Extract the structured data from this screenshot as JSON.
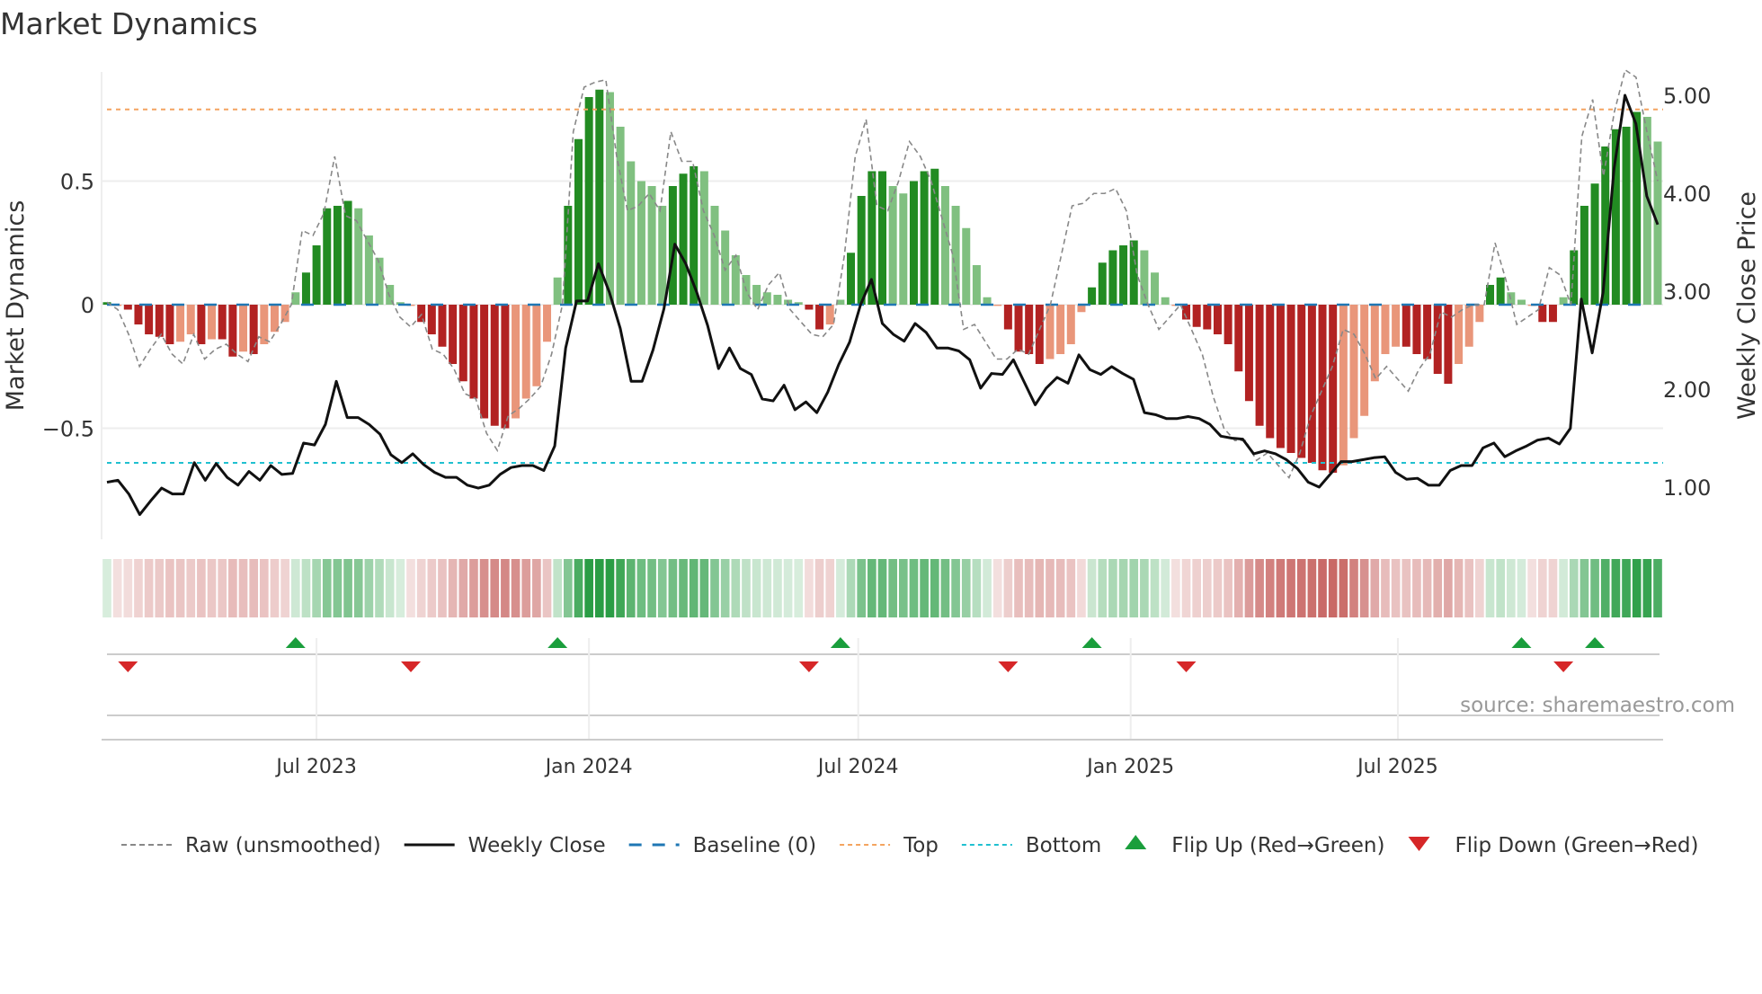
{
  "title": "Market Dynamics",
  "source": "source: sharemaestro.com",
  "colors": {
    "green_dark": "#228b22",
    "green_light": "#80c080",
    "red_dark": "#b22222",
    "red_light": "#e9967a",
    "raw": "#888888",
    "close": "#111111",
    "baseline": "#1f77b4",
    "top": "#f4a460",
    "bottom": "#20c0d0",
    "flip_up": "#1a9e3c",
    "flip_down": "#d62728"
  },
  "chart_data": {
    "type": "bar",
    "title": "Market Dynamics",
    "ylabel": "Market Dynamics",
    "y2label": "Weekly Close Price",
    "ylim": [
      -0.95,
      0.95
    ],
    "y2lim": [
      0.5,
      5.25
    ],
    "yticks": [
      {
        "v": 0.5,
        "label": "0.5"
      },
      {
        "v": 0,
        "label": "0"
      },
      {
        "v": -0.5,
        "label": "−0.5"
      }
    ],
    "y2ticks": [
      {
        "v": 5,
        "label": "5.00"
      },
      {
        "v": 4,
        "label": "4.00"
      },
      {
        "v": 3,
        "label": "3.00"
      },
      {
        "v": 2,
        "label": "2.00"
      },
      {
        "v": 1,
        "label": "1.00"
      }
    ],
    "xticks": [
      {
        "week": 20.0,
        "label": "Jul 2023"
      },
      {
        "week": 46.0,
        "label": "Jan 2024"
      },
      {
        "week": 71.7,
        "label": "Jul 2024"
      },
      {
        "week": 97.7,
        "label": "Jan 2025"
      },
      {
        "week": 123.2,
        "label": "Jul 2025"
      }
    ],
    "top_level": 0.79,
    "bottom_level": -0.64,
    "baseline": 0,
    "bars": [
      0.01,
      -0.005,
      -0.02,
      -0.08,
      -0.12,
      -0.13,
      -0.16,
      -0.15,
      -0.12,
      -0.16,
      -0.14,
      -0.14,
      -0.21,
      -0.19,
      -0.2,
      -0.16,
      -0.11,
      -0.07,
      0.05,
      0.13,
      0.24,
      0.39,
      0.4,
      0.42,
      0.39,
      0.28,
      0.19,
      0.08,
      0.01,
      -0.005,
      -0.07,
      -0.12,
      -0.17,
      -0.24,
      -0.31,
      -0.38,
      -0.46,
      -0.49,
      -0.5,
      -0.46,
      -0.38,
      -0.33,
      -0.15,
      0.11,
      0.4,
      0.67,
      0.84,
      0.87,
      0.86,
      0.72,
      0.58,
      0.5,
      0.48,
      0.4,
      0.48,
      0.53,
      0.56,
      0.54,
      0.4,
      0.3,
      0.2,
      0.12,
      0.08,
      0.05,
      0.04,
      0.02,
      0.01,
      -0.02,
      -0.1,
      -0.08,
      0.02,
      0.21,
      0.44,
      0.54,
      0.54,
      0.48,
      0.45,
      0.5,
      0.54,
      0.55,
      0.48,
      0.4,
      0.31,
      0.16,
      0.03,
      -0.005,
      -0.1,
      -0.19,
      -0.2,
      -0.24,
      -0.22,
      -0.2,
      -0.16,
      -0.03,
      0.07,
      0.17,
      0.22,
      0.24,
      0.26,
      0.22,
      0.13,
      0.03,
      -0.005,
      -0.06,
      -0.09,
      -0.1,
      -0.12,
      -0.16,
      -0.27,
      -0.39,
      -0.49,
      -0.54,
      -0.58,
      -0.6,
      -0.62,
      -0.64,
      -0.67,
      -0.68,
      -0.65,
      -0.54,
      -0.45,
      -0.31,
      -0.2,
      -0.17,
      -0.17,
      -0.2,
      -0.22,
      -0.28,
      -0.32,
      -0.24,
      -0.17,
      -0.07,
      0.08,
      0.11,
      0.05,
      0.02,
      -0.005,
      -0.07,
      -0.07,
      0.03,
      0.22,
      0.4,
      0.49,
      0.64,
      0.71,
      0.72,
      0.78,
      0.76,
      0.66
    ],
    "raw": [
      0.01,
      -0.02,
      -0.12,
      -0.25,
      -0.18,
      -0.12,
      -0.2,
      -0.24,
      -0.12,
      -0.22,
      -0.18,
      -0.16,
      -0.2,
      -0.23,
      -0.13,
      -0.15,
      -0.08,
      0.0,
      0.3,
      0.28,
      0.37,
      0.6,
      0.36,
      0.34,
      0.26,
      0.18,
      0.04,
      -0.05,
      -0.09,
      -0.04,
      -0.18,
      -0.2,
      -0.26,
      -0.36,
      -0.38,
      -0.52,
      -0.59,
      -0.45,
      -0.42,
      -0.38,
      -0.33,
      -0.2,
      0.0,
      0.7,
      0.88,
      0.9,
      0.91,
      0.6,
      0.38,
      0.4,
      0.45,
      0.38,
      0.7,
      0.58,
      0.58,
      0.38,
      0.28,
      0.14,
      0.2,
      0.05,
      -0.02,
      0.08,
      0.13,
      -0.02,
      -0.07,
      -0.12,
      -0.13,
      -0.08,
      0.2,
      0.6,
      0.75,
      0.4,
      0.38,
      0.5,
      0.66,
      0.6,
      0.5,
      0.35,
      0.2,
      -0.1,
      -0.08,
      -0.15,
      -0.22,
      -0.22,
      -0.18,
      -0.2,
      -0.1,
      0.0,
      0.2,
      0.4,
      0.41,
      0.45,
      0.45,
      0.47,
      0.38,
      0.12,
      0.0,
      -0.1,
      -0.05,
      0.0,
      -0.1,
      -0.2,
      -0.37,
      -0.5,
      -0.55,
      -0.55,
      -0.63,
      -0.6,
      -0.65,
      -0.7,
      -0.6,
      -0.45,
      -0.35,
      -0.25,
      -0.1,
      -0.12,
      -0.2,
      -0.3,
      -0.25,
      -0.3,
      -0.35,
      -0.26,
      -0.2,
      -0.03,
      -0.05,
      -0.02,
      0.0,
      0.0,
      0.25,
      0.1,
      -0.08,
      -0.05,
      -0.02,
      0.15,
      0.12,
      0.0,
      0.68,
      0.83,
      0.52,
      0.78,
      0.95,
      0.92,
      0.7,
      0.5
    ],
    "close": [
      1.05,
      1.07,
      0.93,
      0.72,
      0.86,
      0.99,
      0.93,
      0.93,
      1.25,
      1.07,
      1.24,
      1.1,
      1.02,
      1.16,
      1.07,
      1.22,
      1.13,
      1.14,
      1.45,
      1.43,
      1.64,
      2.08,
      1.71,
      1.71,
      1.64,
      1.54,
      1.33,
      1.25,
      1.34,
      1.23,
      1.15,
      1.1,
      1.1,
      1.02,
      0.99,
      1.02,
      1.13,
      1.2,
      1.22,
      1.22,
      1.17,
      1.42,
      2.42,
      2.9,
      2.9,
      3.28,
      2.99,
      2.62,
      2.08,
      2.08,
      2.4,
      2.82,
      3.48,
      3.28,
      2.99,
      2.65,
      2.21,
      2.42,
      2.21,
      2.15,
      1.9,
      1.88,
      2.04,
      1.79,
      1.87,
      1.76,
      1.97,
      2.25,
      2.48,
      2.86,
      3.12,
      2.67,
      2.56,
      2.49,
      2.67,
      2.58,
      2.42,
      2.42,
      2.39,
      2.3,
      2.01,
      2.16,
      2.15,
      2.3,
      2.07,
      1.84,
      2.01,
      2.12,
      2.06,
      2.35,
      2.2,
      2.15,
      2.23,
      2.16,
      2.1,
      1.76,
      1.74,
      1.7,
      1.7,
      1.72,
      1.7,
      1.64,
      1.52,
      1.5,
      1.49,
      1.34,
      1.37,
      1.34,
      1.28,
      1.19,
      1.05,
      1.0,
      1.13,
      1.26,
      1.26,
      1.28,
      1.3,
      1.31,
      1.15,
      1.08,
      1.09,
      1.02,
      1.02,
      1.17,
      1.22,
      1.22,
      1.4,
      1.45,
      1.31,
      1.37,
      1.42,
      1.48,
      1.5,
      1.44,
      1.6,
      2.92,
      2.37,
      2.99,
      4.25,
      5.0,
      4.71,
      3.97,
      3.68
    ],
    "flip_up_weeks": [
      18,
      43,
      70,
      94,
      135,
      142
    ],
    "flip_down_weeks": [
      2,
      29,
      67,
      86,
      103,
      139
    ],
    "legend_position": "bottom"
  },
  "legend": [
    {
      "key": "raw",
      "label": "Raw (unsmoothed)"
    },
    {
      "key": "close",
      "label": "Weekly Close"
    },
    {
      "key": "baseline",
      "label": "Baseline (0)"
    },
    {
      "key": "top",
      "label": "Top"
    },
    {
      "key": "bottom",
      "label": "Bottom"
    },
    {
      "key": "up",
      "label": "Flip Up (Red→Green)"
    },
    {
      "key": "down",
      "label": "Flip Down (Green→Red)"
    }
  ]
}
